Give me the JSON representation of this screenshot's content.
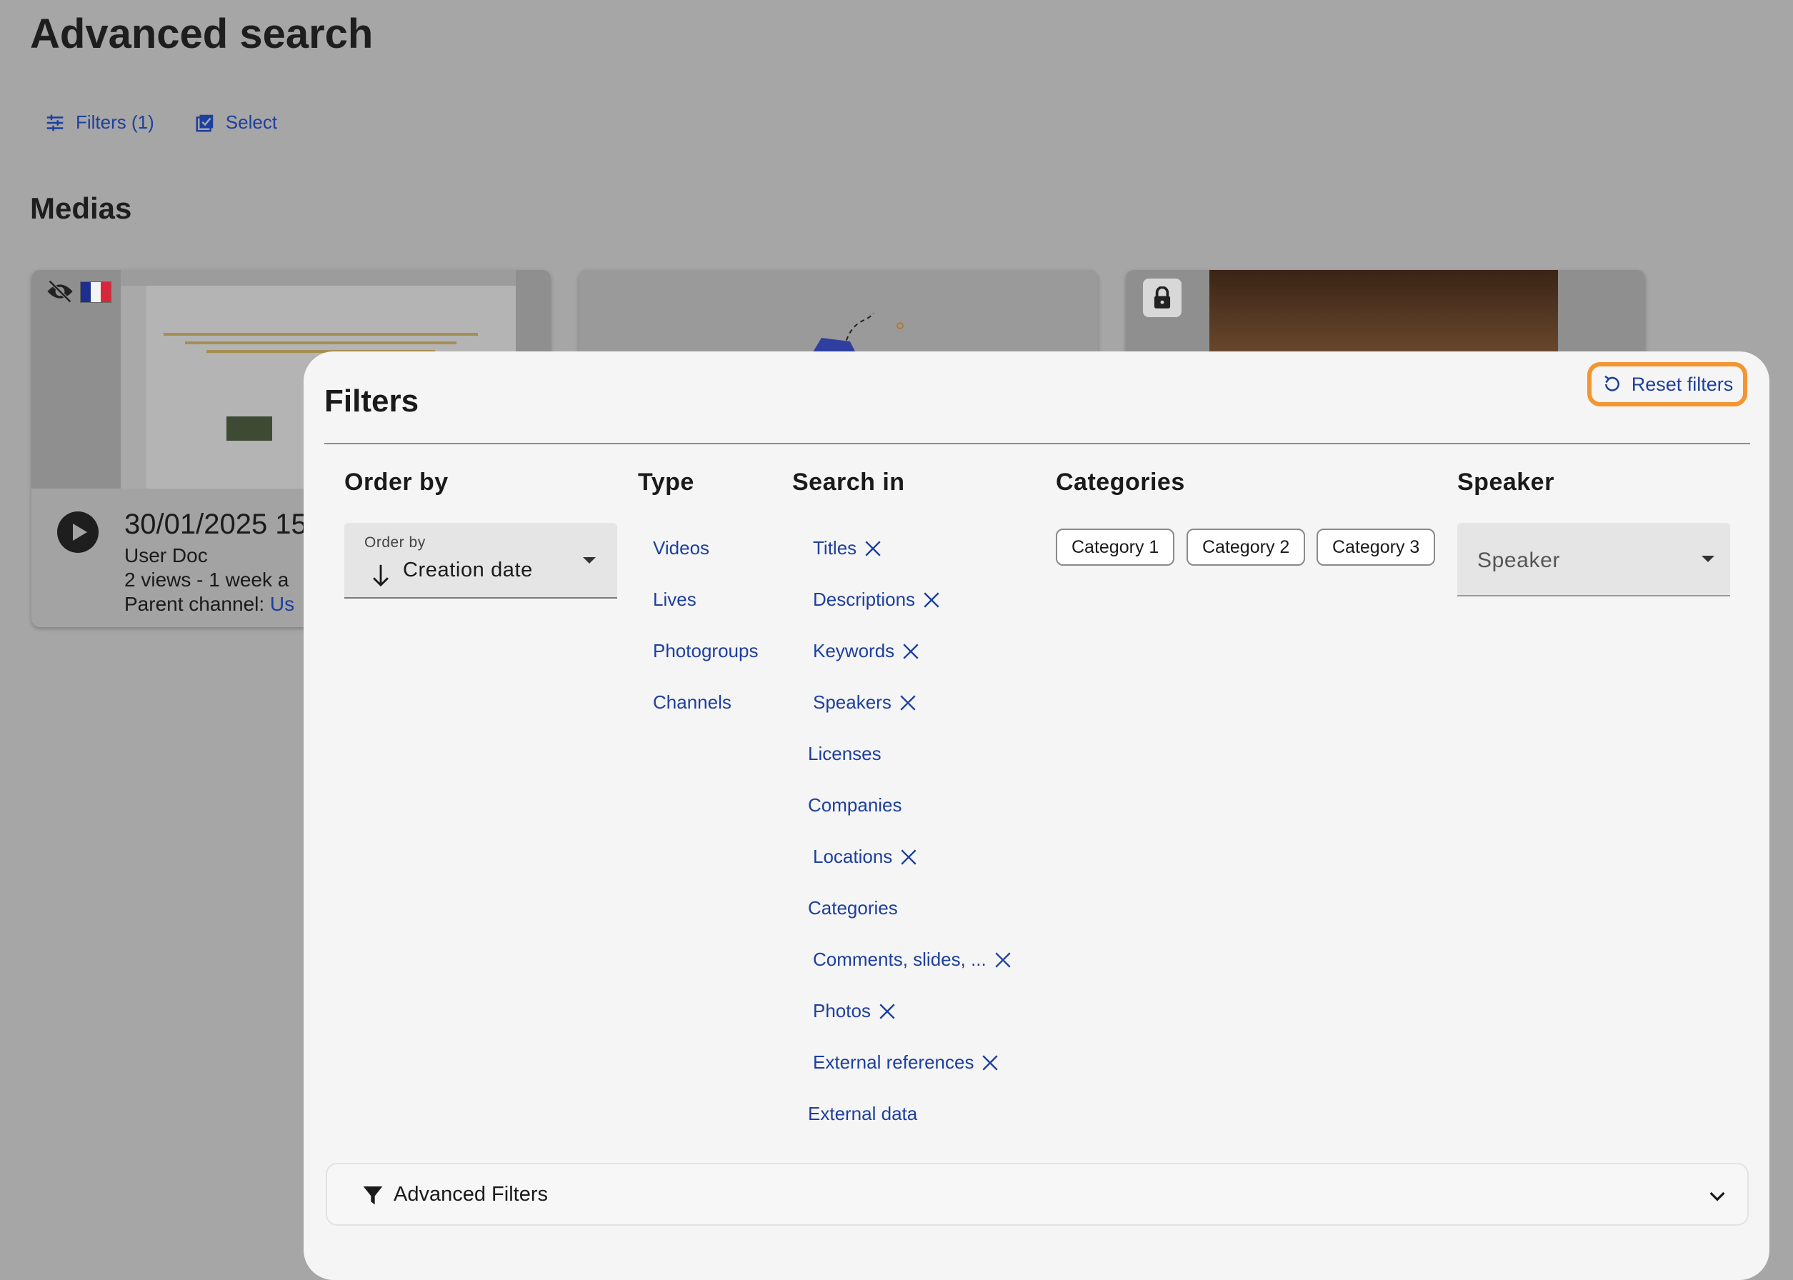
{
  "page": {
    "title": "Advanced search"
  },
  "toolbar": {
    "filters_label": "Filters (1)",
    "select_label": "Select"
  },
  "medias": {
    "title": "Medias",
    "cards": [
      {
        "title": "30/01/2025 15",
        "subtitle": "User Doc",
        "stats": "2 views  - 1 week a",
        "parent_prefix": "Parent channel: ",
        "parent_link": "Us"
      }
    ]
  },
  "filters": {
    "title": "Filters",
    "reset_label": "Reset filters",
    "order_by": {
      "heading": "Order by",
      "label": "Order by",
      "value": "Creation date"
    },
    "type": {
      "heading": "Type",
      "items": [
        "Videos",
        "Lives",
        "Photogroups",
        "Channels"
      ]
    },
    "search_in": {
      "heading": "Search in",
      "items": [
        {
          "label": "Titles",
          "selected": true
        },
        {
          "label": "Descriptions",
          "selected": true
        },
        {
          "label": "Keywords",
          "selected": true
        },
        {
          "label": "Speakers",
          "selected": true
        },
        {
          "label": "Licenses",
          "selected": false
        },
        {
          "label": "Companies",
          "selected": false
        },
        {
          "label": "Locations",
          "selected": true
        },
        {
          "label": "Categories",
          "selected": false
        },
        {
          "label": "Comments, slides, ...",
          "selected": true
        },
        {
          "label": "Photos",
          "selected": true
        },
        {
          "label": "External references",
          "selected": true
        },
        {
          "label": "External data",
          "selected": false
        }
      ]
    },
    "categories": {
      "heading": "Categories",
      "chips": [
        "Category 1",
        "Category 2",
        "Category 3"
      ]
    },
    "speaker": {
      "heading": "Speaker",
      "placeholder": "Speaker"
    },
    "advanced": {
      "label": "Advanced Filters"
    }
  },
  "colors": {
    "link": "#1d3f9e",
    "reset_outline": "#f39530",
    "overlay": "#a6a6a6",
    "panel": "#f5f5f5"
  },
  "icons": [
    "sliders-icon",
    "checkbox-icon",
    "eye-off-icon",
    "flag-fr-icon",
    "play-icon",
    "lock-icon",
    "refresh-icon",
    "arrow-down-icon",
    "caret-down-icon",
    "close-icon",
    "funnel-icon",
    "chevron-down-icon"
  ]
}
